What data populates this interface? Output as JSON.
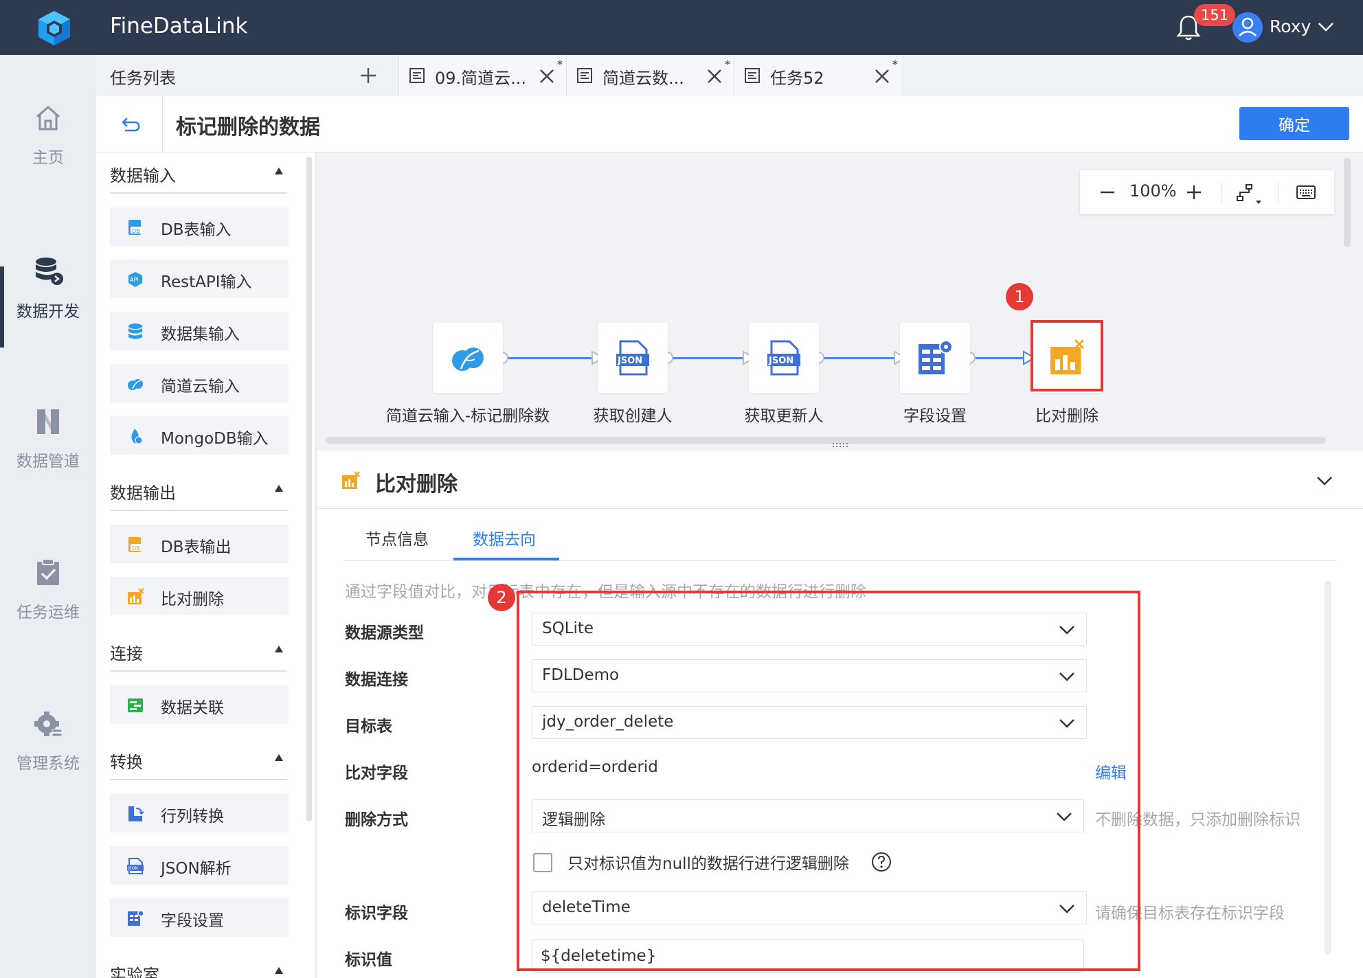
{
  "header": {
    "app_title": "FineDataLink",
    "notification_count": "151",
    "user_name": "Roxy",
    "icons": {
      "logo": "cube-logo-icon",
      "bell": "bell-icon",
      "avatar": "user-avatar-icon",
      "menu": "chevron-down-icon"
    },
    "colors": {
      "bar": "#2d3a4f",
      "badge": "#e84a4a",
      "avatar": "#3b7ff0"
    }
  },
  "nav": {
    "items": [
      {
        "label": "主页",
        "icon": "home-icon"
      },
      {
        "label": "数据开发",
        "icon": "database-icon",
        "active": true
      },
      {
        "label": "数据管道",
        "icon": "pipeline-icon"
      },
      {
        "label": "任务运维",
        "icon": "clipboard-check-icon"
      },
      {
        "label": "管理系统",
        "icon": "settings-gear-icon"
      }
    ]
  },
  "tabs": {
    "task_list_label": "任务列表",
    "items": [
      {
        "title": "09.简道云...",
        "modified": "*"
      },
      {
        "title": "简道云数...",
        "modified": "*"
      },
      {
        "title": "任务52",
        "modified": "*"
      }
    ]
  },
  "titlebar": {
    "title": "标记删除的数据",
    "confirm_label": "确定"
  },
  "components": {
    "sections": [
      {
        "label": "数据输入",
        "items": [
          "DB表输入",
          "RestAPI输入",
          "数据集输入",
          "简道云输入",
          "MongoDB输入"
        ]
      },
      {
        "label": "数据输出",
        "items": [
          "DB表输出",
          "比对删除"
        ]
      },
      {
        "label": "连接",
        "items": [
          "数据关联"
        ]
      },
      {
        "label": "转换",
        "items": [
          "行列转换",
          "JSON解析",
          "字段设置"
        ]
      },
      {
        "label": "实验室",
        "items": []
      }
    ]
  },
  "canvas": {
    "zoom": "100%",
    "nodes": [
      {
        "label": "简道云输入-标记删除数",
        "icon": "jiandaoyun-cloud-icon"
      },
      {
        "label": "获取创建人",
        "icon": "json-file-icon",
        "icon_text": "JSON"
      },
      {
        "label": "获取更新人",
        "icon": "json-file-icon",
        "icon_text": "JSON"
      },
      {
        "label": "字段设置",
        "icon": "field-settings-icon"
      },
      {
        "label": "比对删除",
        "icon": "compare-delete-icon"
      }
    ],
    "markers": [
      "1",
      "2"
    ]
  },
  "detail": {
    "title": "比对删除",
    "tabs": [
      "节点信息",
      "数据去向"
    ],
    "active_tab": "数据去向",
    "description": "通过字段值对比，对目标表中存在，但是输入源中不存在的数据行进行删除",
    "fields": {
      "source_type": {
        "label": "数据源类型",
        "value": "SQLite"
      },
      "connection": {
        "label": "数据连接",
        "value": "FDLDemo"
      },
      "target_table": {
        "label": "目标表",
        "value": "jdy_order_delete"
      },
      "compare_field": {
        "label": "比对字段",
        "value": "orderid=orderid",
        "action": "编辑"
      },
      "delete_mode": {
        "label": "删除方式",
        "value": "逻辑删除",
        "hint": "不删除数据，只添加删除标识"
      },
      "null_only": {
        "label": "只对标识值为null的数据行进行逻辑删除",
        "checked": false
      },
      "flag_field": {
        "label": "标识字段",
        "value": "deleteTime",
        "hint": "请确保目标表存在标识字段"
      },
      "flag_value": {
        "label": "标识值",
        "value": "${deletetime}"
      }
    }
  }
}
